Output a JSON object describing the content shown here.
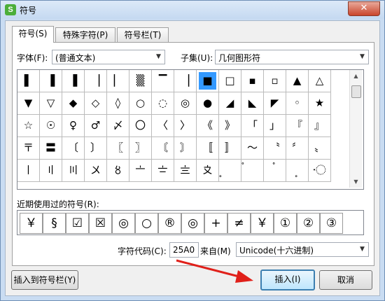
{
  "window": {
    "title": "符号",
    "app_icon_glyph": "S",
    "close_glyph": "✕"
  },
  "tabs": [
    {
      "label": "符号(S)"
    },
    {
      "label": "特殊字符(P)"
    },
    {
      "label": "符号栏(T)"
    }
  ],
  "font": {
    "label": "字体(F):",
    "value": "(普通文本)"
  },
  "subset": {
    "label": "子集(U):",
    "value": "几何图形符"
  },
  "symbols": [
    [
      "▌",
      "▐",
      "▐",
      "▕",
      "▏",
      "▒",
      "▔",
      "▕",
      "■",
      "□",
      "▪",
      "▫",
      "▲",
      "△"
    ],
    [
      "▼",
      "▽",
      "◆",
      "◇",
      "◊",
      "○",
      "◌",
      "◎",
      "●",
      "◢",
      "◣",
      "◤",
      "◦",
      "★"
    ],
    [
      "☆",
      "☉",
      "♀",
      "♂",
      "〆",
      "〇",
      "〈",
      "〉",
      "《",
      "》",
      "「",
      "」",
      "『",
      "』"
    ],
    [
      "〒",
      "〓",
      "〔",
      "〕",
      "〖",
      "〗",
      "〘",
      "〙",
      "〚",
      "〛",
      "〜",
      "〝",
      "〞",
      "〟"
    ],
    [
      "〡",
      "〢",
      "〣",
      "〤",
      "〥",
      "〦",
      "〧",
      "〨",
      "〩",
      "〪",
      "〫",
      "〬",
      "〭",
      "〮"
    ]
  ],
  "selected_symbol": "■",
  "recent": {
    "label": "近期使用过的符号(R):",
    "symbols": [
      "￥",
      "§",
      "☑",
      "☒",
      "◎",
      "○",
      "®",
      "◎",
      "+",
      "≠",
      "￥",
      "①",
      "②",
      "③"
    ]
  },
  "char_code": {
    "label": "字符代码(C):",
    "value": "25A0"
  },
  "from": {
    "label": "来自(M)",
    "value": "Unicode(十六进制)"
  },
  "buttons": {
    "insert_to_bar": "插入到符号栏(Y)",
    "insert": "插入(I)",
    "cancel": "取消"
  },
  "colors": {
    "selection": "#3399ff",
    "arrow": "#e0201a",
    "title_bar": "#c5d9f1"
  }
}
